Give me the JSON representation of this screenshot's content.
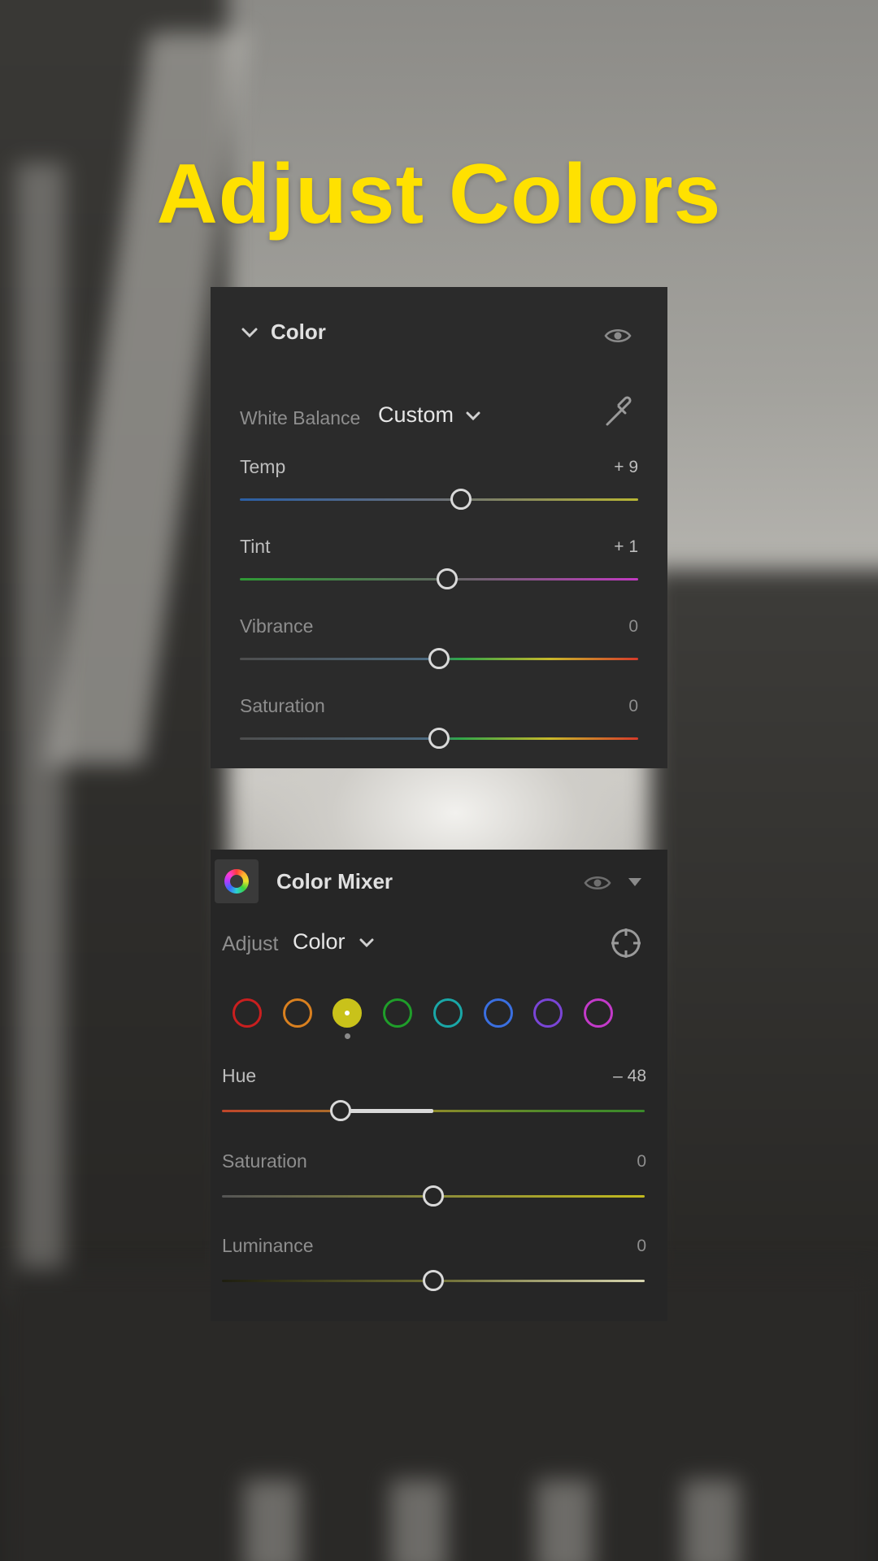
{
  "headline": "Adjust Colors",
  "color_panel": {
    "title": "Color",
    "white_balance_label": "White Balance",
    "white_balance_value": "Custom",
    "sliders": [
      {
        "label": "Temp",
        "value": "+ 9",
        "position": 0.555
      },
      {
        "label": "Tint",
        "value": "+ 1",
        "position": 0.52
      },
      {
        "label": "Vibrance",
        "value": "0",
        "position": 0.5
      },
      {
        "label": "Saturation",
        "value": "0",
        "position": 0.5
      }
    ]
  },
  "mixer_panel": {
    "title": "Color Mixer",
    "adjust_label": "Adjust",
    "adjust_value": "Color",
    "swatches": [
      "#c91f1f",
      "#d9801f",
      "#c9c21a",
      "#1f9e2a",
      "#1aa7a7",
      "#3a6fe0",
      "#7a45d6",
      "#c33ac9"
    ],
    "selected_swatch": 2,
    "sliders": [
      {
        "label": "Hue",
        "value": "– 48",
        "position": 0.28
      },
      {
        "label": "Saturation",
        "value": "0",
        "position": 0.5
      },
      {
        "label": "Luminance",
        "value": "0",
        "position": 0.5
      }
    ]
  },
  "colors": {
    "headline": "#ffe100",
    "panel_bg": "#2b2b2b"
  }
}
